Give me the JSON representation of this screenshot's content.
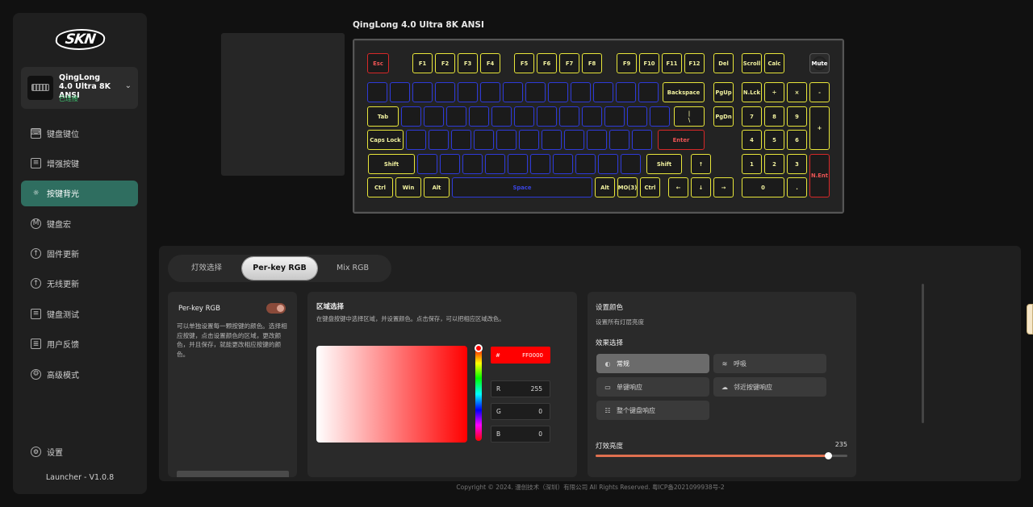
{
  "brand": {
    "logo": "SKN"
  },
  "device": {
    "name": "QingLong 4.0 Ultra 8K ANSI",
    "status": "已连接"
  },
  "nav": {
    "items": [
      {
        "label": "键盘键位",
        "icon": "keyboard-icon"
      },
      {
        "label": "增强按键",
        "icon": "enhanced-key-icon"
      },
      {
        "label": "按键背光",
        "icon": "backlight-icon"
      },
      {
        "label": "键盘宏",
        "icon": "macro-icon"
      },
      {
        "label": "固件更新",
        "icon": "firmware-update-icon"
      },
      {
        "label": "无线更新",
        "icon": "wireless-update-icon"
      },
      {
        "label": "键盘测试",
        "icon": "keyboard-test-icon"
      },
      {
        "label": "用户反馈",
        "icon": "feedback-icon"
      },
      {
        "label": "高级模式",
        "icon": "advanced-mode-icon"
      }
    ],
    "active": "按键背光",
    "settings_label": "设置",
    "version": "Launcher - V1.0.8"
  },
  "keyboard": {
    "title": "QingLong 4.0 Ultra 8K ANSI",
    "keys": {
      "esc": "Esc",
      "f1": "F1",
      "f2": "F2",
      "f3": "F3",
      "f4": "F4",
      "f5": "F5",
      "f6": "F6",
      "f7": "F7",
      "f8": "F8",
      "f9": "F9",
      "f10": "F10",
      "f11": "F11",
      "f12": "F12",
      "del": "Del",
      "scroll": "Scroll",
      "calc": "Calc",
      "mute": "Mute",
      "backspace": "Backspace",
      "pgup": "PgUp",
      "nlck": "N.Lck",
      "div": "÷",
      "mul": "×",
      "minus": "-",
      "tab": "Tab",
      "backslash": "|\n\\",
      "pgdn": "PgDn",
      "n7": "7",
      "n8": "8",
      "n9": "9",
      "plus": "+",
      "caps": "Caps Lock",
      "enter": "Enter",
      "n4": "4",
      "n5": "5",
      "n6": "6",
      "lshift": "Shift",
      "rshift": "Shift",
      "up": "↑",
      "n1": "1",
      "n2": "2",
      "n3": "3",
      "nent": "N.Ent",
      "lctrl": "Ctrl",
      "win": "Win",
      "lalt": "Alt",
      "space": "Space",
      "ralt": "Alt",
      "mo3": "MO(3)",
      "rctrl": "Ctrl",
      "left": "←",
      "down": "↓",
      "right": "→",
      "n0": "0",
      "ndot": "."
    }
  },
  "tabs": {
    "items": [
      "灯效选择",
      "Per-key RGB",
      "Mix RGB"
    ],
    "active": "Per-key RGB"
  },
  "perkey": {
    "label": "Per-key RGB",
    "enabled": true,
    "desc": "可以单独设置每一颗按键的颜色。选择相应按键，点击设置颜色的区域，更改颜色，并且保存，就能更改相应按键的颜色。"
  },
  "area": {
    "title": "区域选择",
    "desc": "在键盘按键中选择区域，并设置颜色。点击保存，可以把相应区域改色。",
    "hex_prefix": "#",
    "hex": "FF0000",
    "r_label": "R",
    "r": "255",
    "g_label": "G",
    "g": "0",
    "b_label": "B",
    "b": "0",
    "color": "#ff0000"
  },
  "color_settings": {
    "title": "设置颜色",
    "desc": "设置所有灯层亮度",
    "effect_title": "效果选择",
    "effects": [
      {
        "label": "常规",
        "icon": "palette-icon"
      },
      {
        "label": "呼吸",
        "icon": "breath-icon"
      },
      {
        "label": "单键响应",
        "icon": "single-key-icon"
      },
      {
        "label": "邻近按键响应",
        "icon": "nearby-key-icon"
      },
      {
        "label": "整个键盘响应",
        "icon": "full-keyboard-icon"
      }
    ],
    "active_effect": "常规",
    "brightness_label": "灯效亮度",
    "brightness": "235",
    "brightness_max": 255,
    "accent": "#e07050"
  },
  "footer": {
    "copyright": "Copyright © 2024. 漫创技术（深圳）有限公司 All Rights Reserved. 粤ICP备2021099938号-2"
  }
}
